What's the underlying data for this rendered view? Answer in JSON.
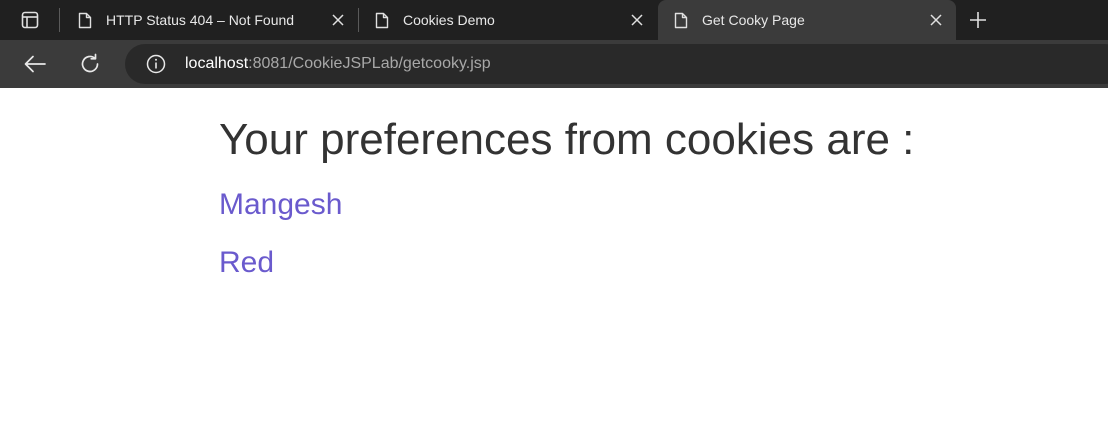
{
  "browser": {
    "tabs": [
      {
        "title": "HTTP Status 404 – Not Found",
        "active": false
      },
      {
        "title": "Cookies Demo",
        "active": false
      },
      {
        "title": "Get Cooky Page",
        "active": true
      }
    ],
    "address": {
      "host": "localhost",
      "rest": ":8081/CookieJSPLab/getcooky.jsp"
    }
  },
  "page": {
    "heading": "Your preferences from cookies are :",
    "preferences": [
      "Mangesh",
      "Red"
    ]
  },
  "colors": {
    "tabbar": "#202020",
    "toolbar": "#3b3b3b",
    "omnibox": "#292929",
    "heading": "#333333",
    "preference_text": "#6a5acd"
  },
  "icons": {
    "tab_actions": "tab-actions-icon",
    "page": "page-icon",
    "close": "close-icon",
    "new_tab": "plus-icon",
    "back": "back-arrow-icon",
    "refresh": "refresh-icon",
    "site_info": "info-icon"
  }
}
